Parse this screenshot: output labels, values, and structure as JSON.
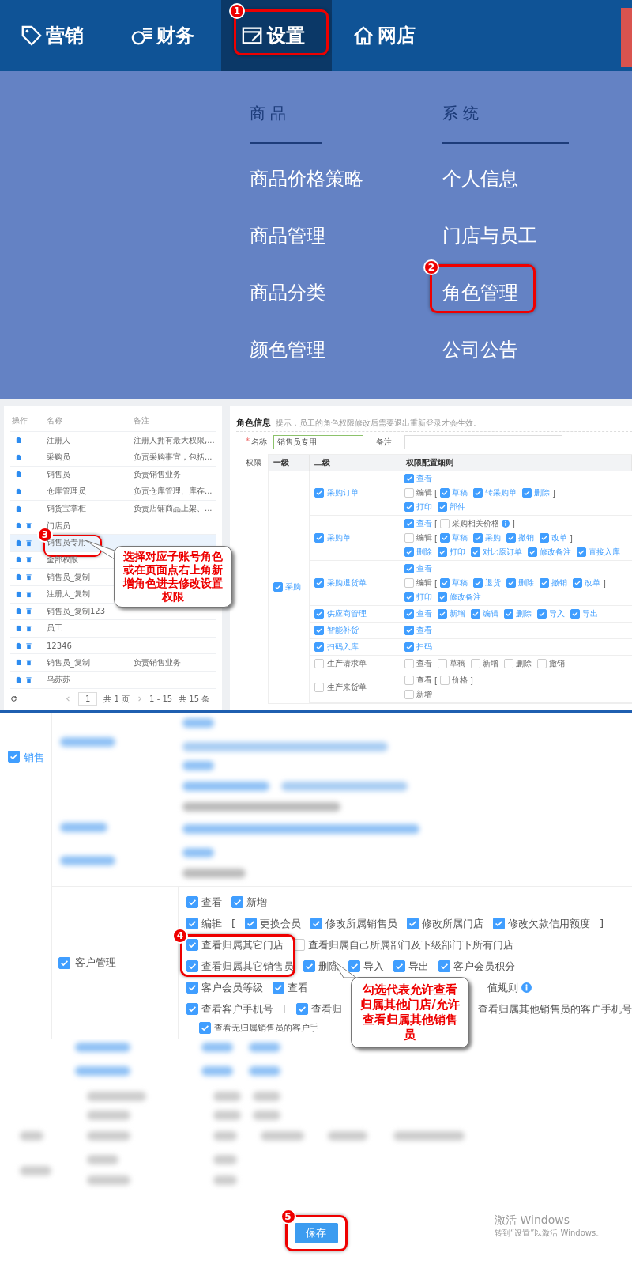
{
  "nav": {
    "items": [
      {
        "label": "营销",
        "selected": false
      },
      {
        "label": "财务",
        "selected": false
      },
      {
        "label": "设置",
        "selected": true,
        "annotation": "1"
      },
      {
        "label": "网店",
        "selected": false
      }
    ]
  },
  "menu": {
    "columns": [
      {
        "heading": "商品",
        "items": [
          {
            "label": "商品价格策略"
          },
          {
            "label": "商品管理"
          },
          {
            "label": "商品分类"
          },
          {
            "label": "颜色管理"
          }
        ]
      },
      {
        "heading": "系统",
        "items": [
          {
            "label": "个人信息"
          },
          {
            "label": "门店与员工"
          },
          {
            "label": "角色管理",
            "annotation": "2"
          },
          {
            "label": "公司公告"
          }
        ]
      }
    ]
  },
  "roles_table": {
    "columns": [
      "操作",
      "名称",
      "备注"
    ],
    "rows": [
      {
        "name": "注册人",
        "note": "注册人拥有最大权限,...",
        "deletable": false,
        "selected": false
      },
      {
        "name": "采购员",
        "note": "负责采购事宜，包括...",
        "deletable": false,
        "selected": false
      },
      {
        "name": "销售员",
        "note": "负责销售业务",
        "deletable": false,
        "selected": false
      },
      {
        "name": "仓库管理员",
        "note": "负责仓库管理、库存...",
        "deletable": false,
        "selected": false
      },
      {
        "name": "销货宝掌柜",
        "note": "负责店铺商品上架、...",
        "deletable": false,
        "selected": false
      },
      {
        "name": "门店员",
        "deletable": true,
        "selected": false
      },
      {
        "name": "销售员专用",
        "deletable": true,
        "selected": true,
        "annotation": "3"
      },
      {
        "name": "全部权限",
        "deletable": true,
        "selected": false
      },
      {
        "name": "销售员_复制",
        "deletable": true,
        "selected": false
      },
      {
        "name": "注册人_复制",
        "deletable": true,
        "selected": false
      },
      {
        "name": "销售员_复制123",
        "deletable": true,
        "selected": false
      },
      {
        "name": "员工",
        "deletable": true,
        "selected": false
      },
      {
        "name": "12346",
        "deletable": true,
        "selected": false
      },
      {
        "name": "销售员_复制",
        "note": "负责销售业务",
        "deletable": true,
        "selected": false
      },
      {
        "name": "乌苏苏",
        "deletable": true,
        "selected": false
      }
    ],
    "pagination": {
      "page": "1",
      "pages": "共 1 页",
      "range": "1 - 15",
      "total": "共 15 条"
    },
    "callout": "选择对应子账号角色或在页面点右上角新增角色进去修改设置权限"
  },
  "role_info": {
    "title": "角色信息",
    "hint": "提示：员工的角色权限修改后需要退出重新登录才会生效。",
    "required_mark": "*",
    "name_label": "名称",
    "name_value": "销售员专用",
    "note_label": "备注",
    "perm_label": "权限",
    "columns": [
      "一级",
      "二级",
      "权限配置细则"
    ],
    "groups": [
      {
        "label": "采购",
        "checked": true,
        "rows": [
          {
            "label": "采购订单",
            "checked": true,
            "lines": [
              [
                {
                  "kind": "check",
                  "label": "查看",
                  "checked": true
                }
              ],
              [
                {
                  "kind": "check",
                  "label": "编辑",
                  "checked": false
                },
                {
                  "kind": "text",
                  "label": "["
                },
                {
                  "kind": "check",
                  "label": "草稿",
                  "checked": true
                },
                {
                  "kind": "check",
                  "label": "转采购单",
                  "checked": true
                },
                {
                  "kind": "check",
                  "label": "删除",
                  "checked": true
                },
                {
                  "kind": "text",
                  "label": "]"
                }
              ],
              [
                {
                  "kind": "check",
                  "label": "打印",
                  "checked": true
                },
                {
                  "kind": "check",
                  "label": "部件",
                  "checked": true
                }
              ]
            ]
          },
          {
            "label": "采购单",
            "checked": true,
            "lines": [
              [
                {
                  "kind": "check",
                  "label": "查看",
                  "checked": true
                },
                {
                  "kind": "text",
                  "label": "["
                },
                {
                  "kind": "check",
                  "label": "采购相关价格",
                  "checked": false,
                  "info": true
                },
                {
                  "kind": "text",
                  "label": "]"
                }
              ],
              [
                {
                  "kind": "check",
                  "label": "编辑",
                  "checked": false
                },
                {
                  "kind": "text",
                  "label": "["
                },
                {
                  "kind": "check",
                  "label": "草稿",
                  "checked": true
                },
                {
                  "kind": "check",
                  "label": "采购",
                  "checked": true
                },
                {
                  "kind": "check",
                  "label": "撤销",
                  "checked": true
                },
                {
                  "kind": "check",
                  "label": "改单",
                  "checked": true
                },
                {
                  "kind": "text",
                  "label": "]"
                }
              ],
              [
                {
                  "kind": "check",
                  "label": "删除",
                  "checked": true
                },
                {
                  "kind": "check",
                  "label": "打印",
                  "checked": true
                },
                {
                  "kind": "check",
                  "label": "对比原订单",
                  "checked": true
                },
                {
                  "kind": "check",
                  "label": "修改备注",
                  "checked": true
                },
                {
                  "kind": "check",
                  "label": "直接入库",
                  "checked": true
                }
              ]
            ]
          },
          {
            "label": "采购退货单",
            "checked": true,
            "lines": [
              [
                {
                  "kind": "check",
                  "label": "查看",
                  "checked": true
                }
              ],
              [
                {
                  "kind": "check",
                  "label": "编辑",
                  "checked": false
                },
                {
                  "kind": "text",
                  "label": "["
                },
                {
                  "kind": "check",
                  "label": "草稿",
                  "checked": true
                },
                {
                  "kind": "check",
                  "label": "退货",
                  "checked": true
                },
                {
                  "kind": "check",
                  "label": "删除",
                  "checked": true
                },
                {
                  "kind": "check",
                  "label": "撤销",
                  "checked": true
                },
                {
                  "kind": "check",
                  "label": "改单",
                  "checked": true
                },
                {
                  "kind": "text",
                  "label": "]"
                }
              ],
              [
                {
                  "kind": "check",
                  "label": "打印",
                  "checked": true
                },
                {
                  "kind": "check",
                  "label": "修改备注",
                  "checked": true
                }
              ]
            ]
          },
          {
            "label": "供应商管理",
            "checked": true,
            "lines": [
              [
                {
                  "kind": "check",
                  "label": "查看",
                  "checked": true
                },
                {
                  "kind": "check",
                  "label": "新增",
                  "checked": true
                },
                {
                  "kind": "check",
                  "label": "编辑",
                  "checked": true
                },
                {
                  "kind": "check",
                  "label": "删除",
                  "checked": true
                },
                {
                  "kind": "check",
                  "label": "导入",
                  "checked": true
                },
                {
                  "kind": "check",
                  "label": "导出",
                  "checked": true
                }
              ]
            ]
          },
          {
            "label": "智能补货",
            "checked": true,
            "lines": [
              [
                {
                  "kind": "check",
                  "label": "查看",
                  "checked": true
                }
              ]
            ]
          },
          {
            "label": "扫码入库",
            "checked": true,
            "lines": [
              [
                {
                  "kind": "check",
                  "label": "扫码",
                  "checked": true
                }
              ]
            ]
          },
          {
            "label": "生产请求单",
            "checked": false,
            "lines": [
              [
                {
                  "kind": "check",
                  "label": "查看",
                  "checked": false
                },
                {
                  "kind": "check",
                  "label": "草稿",
                  "checked": false
                },
                {
                  "kind": "check",
                  "label": "新增",
                  "checked": false
                },
                {
                  "kind": "check",
                  "label": "删除",
                  "checked": false
                },
                {
                  "kind": "check",
                  "label": "撤销",
                  "checked": false
                }
              ]
            ]
          },
          {
            "label": "生产来货单",
            "checked": false,
            "lines": [
              [
                {
                  "kind": "check",
                  "label": "查看",
                  "checked": false
                },
                {
                  "kind": "text",
                  "label": "["
                },
                {
                  "kind": "check",
                  "label": "价格",
                  "checked": false
                },
                {
                  "kind": "text",
                  "label": "]"
                }
              ],
              [
                {
                  "kind": "check",
                  "label": "新增",
                  "checked": false
                }
              ]
            ]
          }
        ]
      }
    ]
  },
  "sales": {
    "label": "销售",
    "checked": true,
    "customer": {
      "label": "客户管理",
      "checked": true,
      "annotation": "4",
      "callout": "勾选代表允许查看归属其他门店/允许查看归属其他销售员",
      "lines": [
        [
          {
            "kind": "check",
            "label": "查看",
            "checked": true
          },
          {
            "kind": "check",
            "label": "新增",
            "checked": true
          }
        ],
        [
          {
            "kind": "check",
            "label": "编辑",
            "checked": true
          },
          {
            "kind": "text",
            "label": "["
          },
          {
            "kind": "check",
            "label": "更换会员",
            "checked": true
          },
          {
            "kind": "check",
            "label": "修改所属销售员",
            "checked": true
          },
          {
            "kind": "check",
            "label": "修改所属门店",
            "checked": true
          },
          {
            "kind": "check",
            "label": "修改欠款信用额度",
            "checked": true
          },
          {
            "kind": "text",
            "label": "]"
          }
        ],
        [
          {
            "kind": "check",
            "label": "查看归属其它门店",
            "checked": true
          },
          {
            "kind": "check",
            "label": "查看归属自己所属部门及下级部门下所有门店",
            "checked": false
          }
        ],
        [
          {
            "kind": "check",
            "label": "查看归属其它销售员",
            "checked": true
          },
          {
            "kind": "check",
            "label": "删除",
            "checked": true
          },
          {
            "kind": "check",
            "label": "导入",
            "checked": true
          },
          {
            "kind": "check",
            "label": "导出",
            "checked": true
          },
          {
            "kind": "check",
            "label": "客户会员积分",
            "checked": true
          }
        ],
        [
          {
            "kind": "check",
            "label": "客户会员等级",
            "checked": true
          },
          {
            "kind": "check",
            "label": "查看",
            "checked": true
          },
          {
            "kind": "text",
            "label": "值规则",
            "info": true
          }
        ],
        [
          {
            "kind": "check",
            "label": "查看客户手机号",
            "checked": true
          },
          {
            "kind": "text",
            "label": "["
          },
          {
            "kind": "check",
            "label": "查看归",
            "checked": true
          },
          {
            "kind": "text",
            "label": "查看归属其他销售员的客户手机号"
          }
        ],
        [
          {
            "kind": "check",
            "label": "查看无归属销售员的客户手",
            "checked": true
          }
        ]
      ]
    }
  },
  "footer": {
    "save": "保存",
    "annotation": "5"
  },
  "os_notice": {
    "title": "激活 Windows",
    "text": "转到“设置”以激活 Windows。"
  }
}
